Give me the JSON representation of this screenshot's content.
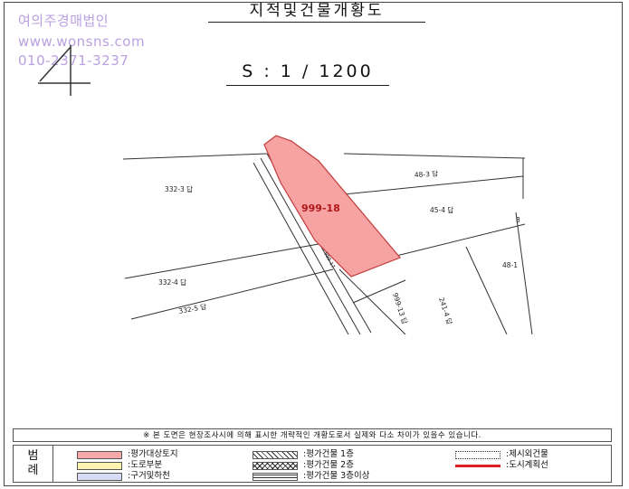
{
  "header": {
    "title": "지적및건물개황도",
    "scale": "S : 1 / 1200"
  },
  "watermark": {
    "line1": "여의주경매법인",
    "line2": "www.wonsns.com",
    "line3": "010-2371-3237"
  },
  "map": {
    "subject_parcel": "999-18",
    "parcel_labels": {
      "p332_3": "332-3 답",
      "p48_3": "48-3 답",
      "p45_4": "45-4 답",
      "p8": "8",
      "p48_1": "48-1",
      "p332_4": "332-4 답",
      "p332_5": "332-5 답",
      "p999_13": "999-13 답",
      "p241_4": "241-4 답",
      "road": "999-17"
    },
    "colors": {
      "subject_fill": "#f7a3a3",
      "subject_stroke": "#c23b3b",
      "subject_label": "#b01818"
    }
  },
  "notice": "※ 본 도면은 현장조사시에 의해 표시한 개략적인 개황도로서 실제와 다소 차이가 있을수 있습니다.",
  "legend": {
    "title_line1": "범",
    "title_line2": "례",
    "items": {
      "subject_land": "평가대상토지",
      "road_part": "도로부분",
      "river": "구거및하천",
      "bldg1": "평가건물 1층",
      "bldg2": "평가건물 2층",
      "bldg3": "평가건물 3층이상",
      "excluded": "제시외건물",
      "plan_line": "도시계획선"
    },
    "colors": {
      "subject_land": "#f7a8a8",
      "road_part": "#fff3b0",
      "river": "#d6dcf6",
      "plan_line": "#e02020"
    }
  }
}
